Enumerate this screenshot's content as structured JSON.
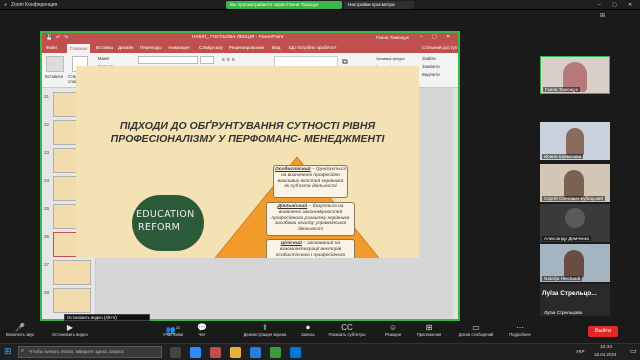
{
  "zoom": {
    "window_title": "Zoom Конференция",
    "presenter_banner": "Вы просматриваете экран Ганни Тімощук",
    "view_options": "Настройки просмотра"
  },
  "ppt": {
    "title": "НУБіП_ ГОСТЬОВА ЛЕКЦІЯ - PowerPoint",
    "user": "Ганна Тимощук",
    "share_label": "Спільний доступ",
    "search": "Що потрібно зробити?",
    "tabs": [
      "Файл",
      "Главная",
      "Вставка",
      "Дизайн",
      "Переходы",
      "Анимация",
      "Слайд-шоу",
      "Рецензирование",
      "Вид"
    ],
    "ribbon": {
      "paste": "Вставити",
      "layout": "Макет",
      "reset": "Скинути",
      "new_slide": "Створити слайд",
      "section": "Розділ",
      "arrange": "Упорядкувати",
      "quick_styles": "Швидкі стилі",
      "shape_fill": "Заливка фігури",
      "shape_outline": "Контур фігури",
      "shape_effects": "Ефекти фігури",
      "find": "Знайти",
      "replace": "Замінити",
      "select": "Виділити"
    },
    "thumb_numbers": [
      "21",
      "22",
      "23",
      "24",
      "25",
      "26",
      "27",
      "28"
    ]
  },
  "slide": {
    "title_line1": "ПІДХОДИ ДО  ОБҐРУНТУВАННЯ СУТНОСТІ РІВНЯ",
    "title_line2": "ПРОФЕСІОНАЛІЗМУ У ПЕРФОМАНС- МЕНЕДЖМЕНТІ",
    "chalk_line1": "EDUCATION",
    "chalk_line2": "REFORM",
    "box1_key": "Особистісний",
    "box1_rest": " – ґрунтується на визначенні професійно важливих якостей керівника як суб'єкта діяльності",
    "box2_key": "Діяльнісний",
    "box2_rest": " – базується на виявленні закономірностей професійного розвитку керівника засобами аналізу управлінської діяльності",
    "box3_key": "Цілісний",
    "box3_rest": " – заснований на взаємоінтеграції векторів особистісного і професійного розвитку керівника"
  },
  "participants": [
    {
      "name": "Ганна Тимощук"
    },
    {
      "name": "Ирина Шумилова"
    },
    {
      "name": "Сергій Олегович Кубицький"
    },
    {
      "name": "Александр Демченко"
    },
    {
      "name": "Natalija Heichardt"
    },
    {
      "name": "Луїза  Стрельцо...",
      "sub": "Луїза Стрельцова"
    }
  ],
  "zoom_controls": {
    "audio": "Включить звук",
    "video": "Остановить видео",
    "participants": "Участники",
    "participants_count": "22",
    "chat": "Чат",
    "share": "Демонстрация экрана",
    "record": "Запись",
    "captions": "Показать субтитры",
    "reactions": "Реакции",
    "apps": "Приложения",
    "whiteboards": "Доски сообщений",
    "more": "Подробнее",
    "leave": "Выйти",
    "tooltip": "Остановить видео (Alt+V)"
  },
  "taskbar": {
    "search": "Чтобы начать поиск, введите здесь запрос",
    "time": "10:44",
    "date": "16.04.2024",
    "lang": "УКР"
  },
  "colors": {
    "accent": "#c0504d",
    "share_border": "#3cb54a",
    "leave": "#e02828",
    "triangle": "#f29b2b"
  }
}
